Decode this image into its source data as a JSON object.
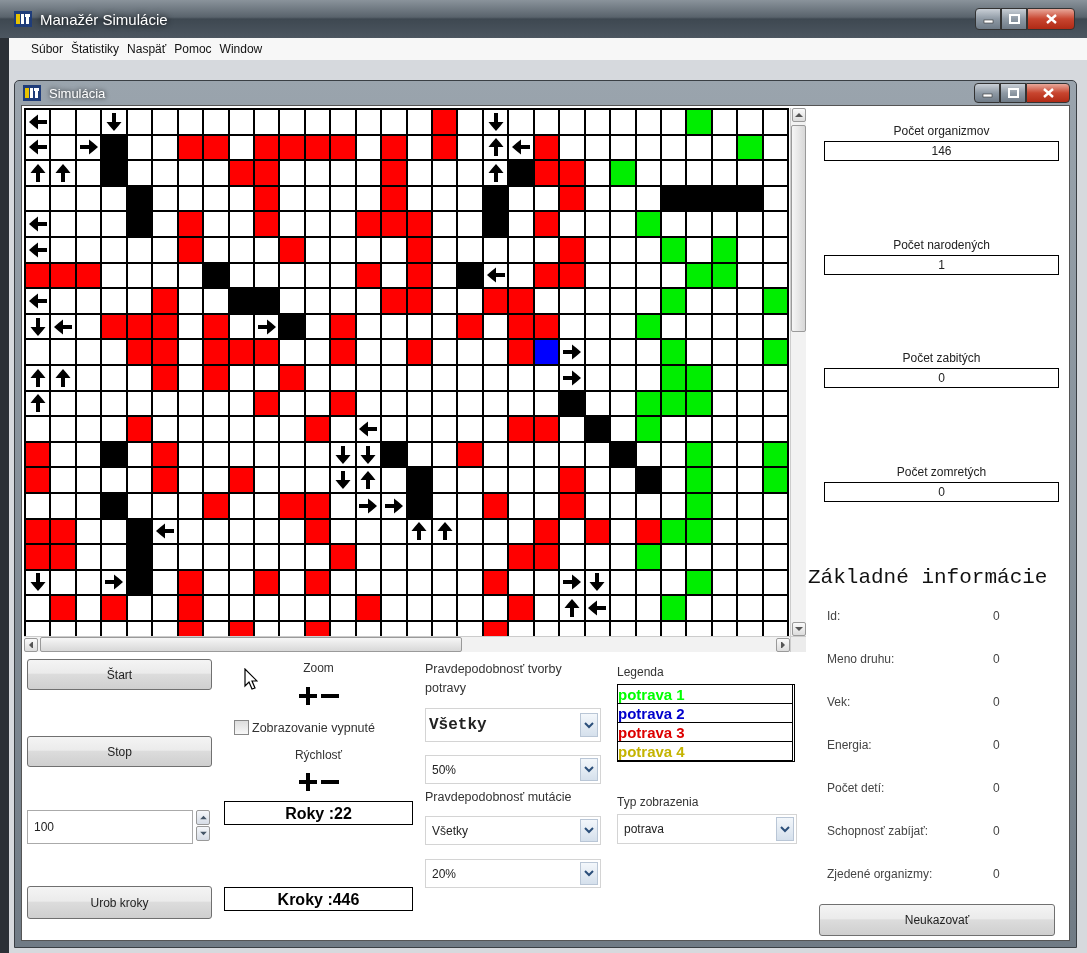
{
  "window": {
    "title": "Manažér Simulácie"
  },
  "menu": [
    "Súbor",
    "Štatistiky",
    "Naspäť",
    "Pomoc",
    "Window"
  ],
  "simulation_window": {
    "title": "Simulácia"
  },
  "grid": {
    "rows": [
      [
        {
          "kind": "arrow_left"
        },
        {
          "kind": "empty"
        },
        {
          "kind": "empty"
        },
        {
          "kind": "arrow_down"
        },
        {
          "kind": "empty"
        },
        {
          "kind": "empty"
        },
        {
          "kind": "empty"
        },
        {
          "kind": "empty"
        },
        {
          "kind": "empty"
        },
        {
          "kind": "empty"
        },
        {
          "kind": "empty"
        },
        {
          "kind": "empty"
        },
        {
          "kind": "empty"
        },
        {
          "kind": "empty"
        },
        {
          "kind": "empty"
        },
        {
          "kind": "empty"
        },
        {
          "kind": "filled",
          "color": "#ff0000"
        },
        {
          "kind": "empty"
        },
        {
          "kind": "arrow_down"
        },
        {
          "kind": "empty"
        },
        {
          "kind": "empty"
        },
        {
          "kind": "empty"
        },
        {
          "kind": "empty"
        },
        {
          "kind": "empty"
        },
        {
          "kind": "empty"
        },
        {
          "kind": "empty"
        },
        {
          "kind": "filled",
          "color": "#00ee00"
        },
        {
          "kind": "empty"
        },
        {
          "kind": "empty"
        },
        {
          "kind": "empty"
        }
      ],
      [
        {
          "kind": "arrow_left"
        },
        {
          "kind": "empty"
        },
        {
          "kind": "arrow_right"
        },
        {
          "kind": "filled",
          "color": "#000000"
        },
        {
          "kind": "empty"
        },
        {
          "kind": "empty"
        },
        {
          "kind": "filled",
          "color": "#ff0000"
        },
        {
          "kind": "filled",
          "color": "#ff0000"
        },
        {
          "kind": "empty"
        },
        {
          "kind": "filled",
          "color": "#ff0000"
        },
        {
          "kind": "filled",
          "color": "#ff0000"
        },
        {
          "kind": "filled",
          "color": "#ff0000"
        },
        {
          "kind": "filled",
          "color": "#ff0000"
        },
        {
          "kind": "empty"
        },
        {
          "kind": "filled",
          "color": "#ff0000"
        },
        {
          "kind": "empty"
        },
        {
          "kind": "filled",
          "color": "#ff0000"
        },
        {
          "kind": "empty"
        },
        {
          "kind": "arrow_up"
        },
        {
          "kind": "arrow_left"
        },
        {
          "kind": "filled",
          "color": "#ff0000"
        },
        {
          "kind": "empty"
        },
        {
          "kind": "empty"
        },
        {
          "kind": "empty"
        },
        {
          "kind": "empty"
        },
        {
          "kind": "empty"
        },
        {
          "kind": "empty"
        },
        {
          "kind": "empty"
        },
        {
          "kind": "filled",
          "color": "#00ee00"
        },
        {
          "kind": "empty"
        }
      ],
      [
        {
          "kind": "arrow_up"
        },
        {
          "kind": "arrow_up"
        },
        {
          "kind": "empty"
        },
        {
          "kind": "filled",
          "color": "#000000"
        },
        {
          "kind": "empty"
        },
        {
          "kind": "empty"
        },
        {
          "kind": "empty"
        },
        {
          "kind": "empty"
        },
        {
          "kind": "filled",
          "color": "#ff0000"
        },
        {
          "kind": "filled",
          "color": "#ff0000"
        },
        {
          "kind": "empty"
        },
        {
          "kind": "empty"
        },
        {
          "kind": "empty"
        },
        {
          "kind": "empty"
        },
        {
          "kind": "filled",
          "color": "#ff0000"
        },
        {
          "kind": "empty"
        },
        {
          "kind": "empty"
        },
        {
          "kind": "empty"
        },
        {
          "kind": "arrow_up"
        },
        {
          "kind": "filled",
          "color": "#000000"
        },
        {
          "kind": "filled",
          "color": "#ff0000"
        },
        {
          "kind": "filled",
          "color": "#ff0000"
        },
        {
          "kind": "empty"
        },
        {
          "kind": "filled",
          "color": "#00ee00"
        },
        {
          "kind": "empty"
        },
        {
          "kind": "empty"
        },
        {
          "kind": "empty"
        },
        {
          "kind": "empty"
        },
        {
          "kind": "empty"
        },
        {
          "kind": "empty"
        }
      ],
      [
        {
          "kind": "empty"
        },
        {
          "kind": "empty"
        },
        {
          "kind": "empty"
        },
        {
          "kind": "empty"
        },
        {
          "kind": "filled",
          "color": "#000000"
        },
        {
          "kind": "empty"
        },
        {
          "kind": "empty"
        },
        {
          "kind": "empty"
        },
        {
          "kind": "empty"
        },
        {
          "kind": "filled",
          "color": "#ff0000"
        },
        {
          "kind": "empty"
        },
        {
          "kind": "empty"
        },
        {
          "kind": "empty"
        },
        {
          "kind": "empty"
        },
        {
          "kind": "filled",
          "color": "#ff0000"
        },
        {
          "kind": "empty"
        },
        {
          "kind": "empty"
        },
        {
          "kind": "empty"
        },
        {
          "kind": "filled",
          "color": "#000000"
        },
        {
          "kind": "empty"
        },
        {
          "kind": "empty"
        },
        {
          "kind": "filled",
          "color": "#ff0000"
        },
        {
          "kind": "empty"
        },
        {
          "kind": "empty"
        },
        {
          "kind": "empty"
        },
        {
          "kind": "filled",
          "color": "#000000"
        },
        {
          "kind": "filled",
          "color": "#000000"
        },
        {
          "kind": "filled",
          "color": "#000000"
        },
        {
          "kind": "filled",
          "color": "#000000"
        },
        {
          "kind": "empty"
        }
      ],
      [
        {
          "kind": "arrow_left"
        },
        {
          "kind": "empty"
        },
        {
          "kind": "empty"
        },
        {
          "kind": "empty"
        },
        {
          "kind": "filled",
          "color": "#000000"
        },
        {
          "kind": "empty"
        },
        {
          "kind": "filled",
          "color": "#ff0000"
        },
        {
          "kind": "empty"
        },
        {
          "kind": "empty"
        },
        {
          "kind": "filled",
          "color": "#ff0000"
        },
        {
          "kind": "empty"
        },
        {
          "kind": "empty"
        },
        {
          "kind": "empty"
        },
        {
          "kind": "filled",
          "color": "#ff0000"
        },
        {
          "kind": "filled",
          "color": "#ff0000"
        },
        {
          "kind": "filled",
          "color": "#ff0000"
        },
        {
          "kind": "empty"
        },
        {
          "kind": "empty"
        },
        {
          "kind": "filled",
          "color": "#000000"
        },
        {
          "kind": "empty"
        },
        {
          "kind": "filled",
          "color": "#ff0000"
        },
        {
          "kind": "empty"
        },
        {
          "kind": "empty"
        },
        {
          "kind": "empty"
        },
        {
          "kind": "filled",
          "color": "#00ee00"
        },
        {
          "kind": "empty"
        },
        {
          "kind": "empty"
        },
        {
          "kind": "empty"
        },
        {
          "kind": "empty"
        },
        {
          "kind": "empty"
        }
      ],
      [
        {
          "kind": "arrow_left"
        },
        {
          "kind": "empty"
        },
        {
          "kind": "empty"
        },
        {
          "kind": "empty"
        },
        {
          "kind": "empty"
        },
        {
          "kind": "empty"
        },
        {
          "kind": "filled",
          "color": "#ff0000"
        },
        {
          "kind": "empty"
        },
        {
          "kind": "empty"
        },
        {
          "kind": "empty"
        },
        {
          "kind": "filled",
          "color": "#ff0000"
        },
        {
          "kind": "empty"
        },
        {
          "kind": "empty"
        },
        {
          "kind": "empty"
        },
        {
          "kind": "empty"
        },
        {
          "kind": "filled",
          "color": "#ff0000"
        },
        {
          "kind": "empty"
        },
        {
          "kind": "empty"
        },
        {
          "kind": "empty"
        },
        {
          "kind": "empty"
        },
        {
          "kind": "empty"
        },
        {
          "kind": "filled",
          "color": "#ff0000"
        },
        {
          "kind": "empty"
        },
        {
          "kind": "empty"
        },
        {
          "kind": "empty"
        },
        {
          "kind": "filled",
          "color": "#00ee00"
        },
        {
          "kind": "empty"
        },
        {
          "kind": "filled",
          "color": "#00ee00"
        },
        {
          "kind": "empty"
        },
        {
          "kind": "empty"
        }
      ],
      [
        {
          "kind": "filled",
          "color": "#ff0000"
        },
        {
          "kind": "filled",
          "color": "#ff0000"
        },
        {
          "kind": "filled",
          "color": "#ff0000"
        },
        {
          "kind": "empty"
        },
        {
          "kind": "empty"
        },
        {
          "kind": "empty"
        },
        {
          "kind": "empty"
        },
        {
          "kind": "filled",
          "color": "#000000"
        },
        {
          "kind": "empty"
        },
        {
          "kind": "empty"
        },
        {
          "kind": "empty"
        },
        {
          "kind": "empty"
        },
        {
          "kind": "empty"
        },
        {
          "kind": "filled",
          "color": "#ff0000"
        },
        {
          "kind": "empty"
        },
        {
          "kind": "filled",
          "color": "#ff0000"
        },
        {
          "kind": "empty"
        },
        {
          "kind": "filled",
          "color": "#000000"
        },
        {
          "kind": "arrow_left"
        },
        {
          "kind": "empty"
        },
        {
          "kind": "filled",
          "color": "#ff0000"
        },
        {
          "kind": "filled",
          "color": "#ff0000"
        },
        {
          "kind": "empty"
        },
        {
          "kind": "empty"
        },
        {
          "kind": "empty"
        },
        {
          "kind": "empty"
        },
        {
          "kind": "filled",
          "color": "#00ee00"
        },
        {
          "kind": "filled",
          "color": "#00ee00"
        },
        {
          "kind": "empty"
        },
        {
          "kind": "empty"
        }
      ],
      [
        {
          "kind": "arrow_left"
        },
        {
          "kind": "empty"
        },
        {
          "kind": "empty"
        },
        {
          "kind": "empty"
        },
        {
          "kind": "empty"
        },
        {
          "kind": "filled",
          "color": "#ff0000"
        },
        {
          "kind": "empty"
        },
        {
          "kind": "empty"
        },
        {
          "kind": "filled",
          "color": "#000000"
        },
        {
          "kind": "filled",
          "color": "#000000"
        },
        {
          "kind": "empty"
        },
        {
          "kind": "empty"
        },
        {
          "kind": "empty"
        },
        {
          "kind": "empty"
        },
        {
          "kind": "filled",
          "color": "#ff0000"
        },
        {
          "kind": "filled",
          "color": "#ff0000"
        },
        {
          "kind": "empty"
        },
        {
          "kind": "empty"
        },
        {
          "kind": "filled",
          "color": "#ff0000"
        },
        {
          "kind": "filled",
          "color": "#ff0000"
        },
        {
          "kind": "empty"
        },
        {
          "kind": "empty"
        },
        {
          "kind": "empty"
        },
        {
          "kind": "empty"
        },
        {
          "kind": "empty"
        },
        {
          "kind": "filled",
          "color": "#00ee00"
        },
        {
          "kind": "empty"
        },
        {
          "kind": "empty"
        },
        {
          "kind": "empty"
        },
        {
          "kind": "filled",
          "color": "#00ee00"
        }
      ],
      [
        {
          "kind": "arrow_down"
        },
        {
          "kind": "arrow_left"
        },
        {
          "kind": "empty"
        },
        {
          "kind": "filled",
          "color": "#ff0000"
        },
        {
          "kind": "filled",
          "color": "#ff0000"
        },
        {
          "kind": "filled",
          "color": "#ff0000"
        },
        {
          "kind": "empty"
        },
        {
          "kind": "filled",
          "color": "#ff0000"
        },
        {
          "kind": "empty"
        },
        {
          "kind": "arrow_right"
        },
        {
          "kind": "filled",
          "color": "#000000"
        },
        {
          "kind": "empty"
        },
        {
          "kind": "filled",
          "color": "#ff0000"
        },
        {
          "kind": "empty"
        },
        {
          "kind": "empty"
        },
        {
          "kind": "empty"
        },
        {
          "kind": "empty"
        },
        {
          "kind": "filled",
          "color": "#ff0000"
        },
        {
          "kind": "empty"
        },
        {
          "kind": "filled",
          "color": "#ff0000"
        },
        {
          "kind": "filled",
          "color": "#ff0000"
        },
        {
          "kind": "empty"
        },
        {
          "kind": "empty"
        },
        {
          "kind": "empty"
        },
        {
          "kind": "filled",
          "color": "#00ee00"
        },
        {
          "kind": "empty"
        },
        {
          "kind": "empty"
        },
        {
          "kind": "empty"
        },
        {
          "kind": "empty"
        },
        {
          "kind": "empty"
        }
      ],
      [
        {
          "kind": "empty"
        },
        {
          "kind": "empty"
        },
        {
          "kind": "empty"
        },
        {
          "kind": "empty"
        },
        {
          "kind": "filled",
          "color": "#ff0000"
        },
        {
          "kind": "filled",
          "color": "#ff0000"
        },
        {
          "kind": "empty"
        },
        {
          "kind": "filled",
          "color": "#ff0000"
        },
        {
          "kind": "filled",
          "color": "#ff0000"
        },
        {
          "kind": "filled",
          "color": "#ff0000"
        },
        {
          "kind": "empty"
        },
        {
          "kind": "empty"
        },
        {
          "kind": "filled",
          "color": "#ff0000"
        },
        {
          "kind": "empty"
        },
        {
          "kind": "empty"
        },
        {
          "kind": "filled",
          "color": "#ff0000"
        },
        {
          "kind": "empty"
        },
        {
          "kind": "empty"
        },
        {
          "kind": "empty"
        },
        {
          "kind": "filled",
          "color": "#ff0000"
        },
        {
          "kind": "filled",
          "color": "#0000ff"
        },
        {
          "kind": "arrow_right"
        },
        {
          "kind": "empty"
        },
        {
          "kind": "empty"
        },
        {
          "kind": "empty"
        },
        {
          "kind": "filled",
          "color": "#00ee00"
        },
        {
          "kind": "empty"
        },
        {
          "kind": "empty"
        },
        {
          "kind": "empty"
        },
        {
          "kind": "filled",
          "color": "#00ee00"
        }
      ],
      [
        {
          "kind": "arrow_up"
        },
        {
          "kind": "arrow_up"
        },
        {
          "kind": "empty"
        },
        {
          "kind": "empty"
        },
        {
          "kind": "empty"
        },
        {
          "kind": "filled",
          "color": "#ff0000"
        },
        {
          "kind": "empty"
        },
        {
          "kind": "filled",
          "color": "#ff0000"
        },
        {
          "kind": "empty"
        },
        {
          "kind": "empty"
        },
        {
          "kind": "filled",
          "color": "#ff0000"
        },
        {
          "kind": "empty"
        },
        {
          "kind": "empty"
        },
        {
          "kind": "empty"
        },
        {
          "kind": "empty"
        },
        {
          "kind": "empty"
        },
        {
          "kind": "empty"
        },
        {
          "kind": "empty"
        },
        {
          "kind": "empty"
        },
        {
          "kind": "empty"
        },
        {
          "kind": "empty"
        },
        {
          "kind": "arrow_right"
        },
        {
          "kind": "empty"
        },
        {
          "kind": "empty"
        },
        {
          "kind": "empty"
        },
        {
          "kind": "filled",
          "color": "#00ee00"
        },
        {
          "kind": "filled",
          "color": "#00ee00"
        },
        {
          "kind": "empty"
        },
        {
          "kind": "empty"
        },
        {
          "kind": "empty"
        }
      ],
      [
        {
          "kind": "arrow_up"
        },
        {
          "kind": "empty"
        },
        {
          "kind": "empty"
        },
        {
          "kind": "empty"
        },
        {
          "kind": "empty"
        },
        {
          "kind": "empty"
        },
        {
          "kind": "empty"
        },
        {
          "kind": "empty"
        },
        {
          "kind": "empty"
        },
        {
          "kind": "filled",
          "color": "#ff0000"
        },
        {
          "kind": "empty"
        },
        {
          "kind": "empty"
        },
        {
          "kind": "filled",
          "color": "#ff0000"
        },
        {
          "kind": "empty"
        },
        {
          "kind": "empty"
        },
        {
          "kind": "empty"
        },
        {
          "kind": "empty"
        },
        {
          "kind": "empty"
        },
        {
          "kind": "empty"
        },
        {
          "kind": "empty"
        },
        {
          "kind": "empty"
        },
        {
          "kind": "filled",
          "color": "#000000"
        },
        {
          "kind": "empty"
        },
        {
          "kind": "empty"
        },
        {
          "kind": "filled",
          "color": "#00ee00"
        },
        {
          "kind": "filled",
          "color": "#00ee00"
        },
        {
          "kind": "filled",
          "color": "#00ee00"
        },
        {
          "kind": "empty"
        },
        {
          "kind": "empty"
        },
        {
          "kind": "empty"
        }
      ],
      [
        {
          "kind": "empty"
        },
        {
          "kind": "empty"
        },
        {
          "kind": "empty"
        },
        {
          "kind": "empty"
        },
        {
          "kind": "filled",
          "color": "#ff0000"
        },
        {
          "kind": "empty"
        },
        {
          "kind": "empty"
        },
        {
          "kind": "empty"
        },
        {
          "kind": "empty"
        },
        {
          "kind": "empty"
        },
        {
          "kind": "empty"
        },
        {
          "kind": "filled",
          "color": "#ff0000"
        },
        {
          "kind": "empty"
        },
        {
          "kind": "arrow_left"
        },
        {
          "kind": "empty"
        },
        {
          "kind": "empty"
        },
        {
          "kind": "empty"
        },
        {
          "kind": "empty"
        },
        {
          "kind": "empty"
        },
        {
          "kind": "filled",
          "color": "#ff0000"
        },
        {
          "kind": "filled",
          "color": "#ff0000"
        },
        {
          "kind": "empty"
        },
        {
          "kind": "filled",
          "color": "#000000"
        },
        {
          "kind": "empty"
        },
        {
          "kind": "filled",
          "color": "#00ee00"
        },
        {
          "kind": "empty"
        },
        {
          "kind": "empty"
        },
        {
          "kind": "empty"
        },
        {
          "kind": "empty"
        },
        {
          "kind": "empty"
        }
      ],
      [
        {
          "kind": "filled",
          "color": "#ff0000"
        },
        {
          "kind": "empty"
        },
        {
          "kind": "empty"
        },
        {
          "kind": "filled",
          "color": "#000000"
        },
        {
          "kind": "empty"
        },
        {
          "kind": "filled",
          "color": "#ff0000"
        },
        {
          "kind": "empty"
        },
        {
          "kind": "empty"
        },
        {
          "kind": "empty"
        },
        {
          "kind": "empty"
        },
        {
          "kind": "empty"
        },
        {
          "kind": "empty"
        },
        {
          "kind": "arrow_down"
        },
        {
          "kind": "arrow_down"
        },
        {
          "kind": "filled",
          "color": "#000000"
        },
        {
          "kind": "empty"
        },
        {
          "kind": "empty"
        },
        {
          "kind": "filled",
          "color": "#ff0000"
        },
        {
          "kind": "empty"
        },
        {
          "kind": "empty"
        },
        {
          "kind": "empty"
        },
        {
          "kind": "empty"
        },
        {
          "kind": "empty"
        },
        {
          "kind": "filled",
          "color": "#000000"
        },
        {
          "kind": "empty"
        },
        {
          "kind": "empty"
        },
        {
          "kind": "filled",
          "color": "#00ee00"
        },
        {
          "kind": "empty"
        },
        {
          "kind": "empty"
        },
        {
          "kind": "filled",
          "color": "#00ee00"
        }
      ],
      [
        {
          "kind": "filled",
          "color": "#ff0000"
        },
        {
          "kind": "empty"
        },
        {
          "kind": "empty"
        },
        {
          "kind": "empty"
        },
        {
          "kind": "empty"
        },
        {
          "kind": "filled",
          "color": "#ff0000"
        },
        {
          "kind": "empty"
        },
        {
          "kind": "empty"
        },
        {
          "kind": "filled",
          "color": "#ff0000"
        },
        {
          "kind": "empty"
        },
        {
          "kind": "empty"
        },
        {
          "kind": "empty"
        },
        {
          "kind": "arrow_down"
        },
        {
          "kind": "arrow_up"
        },
        {
          "kind": "empty"
        },
        {
          "kind": "filled",
          "color": "#000000"
        },
        {
          "kind": "empty"
        },
        {
          "kind": "empty"
        },
        {
          "kind": "empty"
        },
        {
          "kind": "empty"
        },
        {
          "kind": "empty"
        },
        {
          "kind": "filled",
          "color": "#ff0000"
        },
        {
          "kind": "empty"
        },
        {
          "kind": "empty"
        },
        {
          "kind": "filled",
          "color": "#000000"
        },
        {
          "kind": "empty"
        },
        {
          "kind": "filled",
          "color": "#00ee00"
        },
        {
          "kind": "empty"
        },
        {
          "kind": "empty"
        },
        {
          "kind": "filled",
          "color": "#00ee00"
        }
      ],
      [
        {
          "kind": "empty"
        },
        {
          "kind": "empty"
        },
        {
          "kind": "empty"
        },
        {
          "kind": "filled",
          "color": "#000000"
        },
        {
          "kind": "empty"
        },
        {
          "kind": "empty"
        },
        {
          "kind": "empty"
        },
        {
          "kind": "filled",
          "color": "#ff0000"
        },
        {
          "kind": "empty"
        },
        {
          "kind": "empty"
        },
        {
          "kind": "filled",
          "color": "#ff0000"
        },
        {
          "kind": "filled",
          "color": "#ff0000"
        },
        {
          "kind": "empty"
        },
        {
          "kind": "arrow_right"
        },
        {
          "kind": "arrow_right"
        },
        {
          "kind": "filled",
          "color": "#000000"
        },
        {
          "kind": "empty"
        },
        {
          "kind": "empty"
        },
        {
          "kind": "filled",
          "color": "#ff0000"
        },
        {
          "kind": "empty"
        },
        {
          "kind": "empty"
        },
        {
          "kind": "filled",
          "color": "#ff0000"
        },
        {
          "kind": "empty"
        },
        {
          "kind": "empty"
        },
        {
          "kind": "empty"
        },
        {
          "kind": "empty"
        },
        {
          "kind": "filled",
          "color": "#00ee00"
        },
        {
          "kind": "empty"
        },
        {
          "kind": "empty"
        },
        {
          "kind": "empty"
        }
      ],
      [
        {
          "kind": "filled",
          "color": "#ff0000"
        },
        {
          "kind": "filled",
          "color": "#ff0000"
        },
        {
          "kind": "empty"
        },
        {
          "kind": "empty"
        },
        {
          "kind": "filled",
          "color": "#000000"
        },
        {
          "kind": "arrow_left"
        },
        {
          "kind": "empty"
        },
        {
          "kind": "empty"
        },
        {
          "kind": "empty"
        },
        {
          "kind": "empty"
        },
        {
          "kind": "empty"
        },
        {
          "kind": "filled",
          "color": "#ff0000"
        },
        {
          "kind": "empty"
        },
        {
          "kind": "empty"
        },
        {
          "kind": "empty"
        },
        {
          "kind": "arrow_up"
        },
        {
          "kind": "arrow_up"
        },
        {
          "kind": "empty"
        },
        {
          "kind": "empty"
        },
        {
          "kind": "empty"
        },
        {
          "kind": "filled",
          "color": "#ff0000"
        },
        {
          "kind": "empty"
        },
        {
          "kind": "filled",
          "color": "#ff0000"
        },
        {
          "kind": "empty"
        },
        {
          "kind": "filled",
          "color": "#ff0000"
        },
        {
          "kind": "filled",
          "color": "#00ee00"
        },
        {
          "kind": "filled",
          "color": "#00ee00"
        },
        {
          "kind": "empty"
        },
        {
          "kind": "empty"
        },
        {
          "kind": "empty"
        }
      ],
      [
        {
          "kind": "filled",
          "color": "#ff0000"
        },
        {
          "kind": "filled",
          "color": "#ff0000"
        },
        {
          "kind": "empty"
        },
        {
          "kind": "empty"
        },
        {
          "kind": "filled",
          "color": "#000000"
        },
        {
          "kind": "empty"
        },
        {
          "kind": "empty"
        },
        {
          "kind": "empty"
        },
        {
          "kind": "empty"
        },
        {
          "kind": "empty"
        },
        {
          "kind": "empty"
        },
        {
          "kind": "empty"
        },
        {
          "kind": "filled",
          "color": "#ff0000"
        },
        {
          "kind": "empty"
        },
        {
          "kind": "empty"
        },
        {
          "kind": "empty"
        },
        {
          "kind": "empty"
        },
        {
          "kind": "empty"
        },
        {
          "kind": "empty"
        },
        {
          "kind": "filled",
          "color": "#ff0000"
        },
        {
          "kind": "filled",
          "color": "#ff0000"
        },
        {
          "kind": "empty"
        },
        {
          "kind": "empty"
        },
        {
          "kind": "empty"
        },
        {
          "kind": "filled",
          "color": "#00ee00"
        },
        {
          "kind": "empty"
        },
        {
          "kind": "empty"
        },
        {
          "kind": "empty"
        },
        {
          "kind": "empty"
        },
        {
          "kind": "empty"
        }
      ],
      [
        {
          "kind": "arrow_down"
        },
        {
          "kind": "empty"
        },
        {
          "kind": "empty"
        },
        {
          "kind": "arrow_right"
        },
        {
          "kind": "filled",
          "color": "#000000"
        },
        {
          "kind": "empty"
        },
        {
          "kind": "filled",
          "color": "#ff0000"
        },
        {
          "kind": "empty"
        },
        {
          "kind": "empty"
        },
        {
          "kind": "filled",
          "color": "#ff0000"
        },
        {
          "kind": "empty"
        },
        {
          "kind": "filled",
          "color": "#ff0000"
        },
        {
          "kind": "empty"
        },
        {
          "kind": "empty"
        },
        {
          "kind": "empty"
        },
        {
          "kind": "empty"
        },
        {
          "kind": "empty"
        },
        {
          "kind": "empty"
        },
        {
          "kind": "filled",
          "color": "#ff0000"
        },
        {
          "kind": "empty"
        },
        {
          "kind": "empty"
        },
        {
          "kind": "arrow_right"
        },
        {
          "kind": "arrow_down"
        },
        {
          "kind": "empty"
        },
        {
          "kind": "empty"
        },
        {
          "kind": "empty"
        },
        {
          "kind": "filled",
          "color": "#00ee00"
        },
        {
          "kind": "empty"
        },
        {
          "kind": "empty"
        },
        {
          "kind": "empty"
        }
      ],
      [
        {
          "kind": "empty"
        },
        {
          "kind": "filled",
          "color": "#ff0000"
        },
        {
          "kind": "empty"
        },
        {
          "kind": "filled",
          "color": "#ff0000"
        },
        {
          "kind": "empty"
        },
        {
          "kind": "empty"
        },
        {
          "kind": "filled",
          "color": "#ff0000"
        },
        {
          "kind": "empty"
        },
        {
          "kind": "empty"
        },
        {
          "kind": "empty"
        },
        {
          "kind": "empty"
        },
        {
          "kind": "empty"
        },
        {
          "kind": "empty"
        },
        {
          "kind": "filled",
          "color": "#ff0000"
        },
        {
          "kind": "empty"
        },
        {
          "kind": "empty"
        },
        {
          "kind": "empty"
        },
        {
          "kind": "empty"
        },
        {
          "kind": "empty"
        },
        {
          "kind": "filled",
          "color": "#ff0000"
        },
        {
          "kind": "empty"
        },
        {
          "kind": "arrow_up"
        },
        {
          "kind": "arrow_left"
        },
        {
          "kind": "empty"
        },
        {
          "kind": "empty"
        },
        {
          "kind": "filled",
          "color": "#00ee00"
        },
        {
          "kind": "empty"
        },
        {
          "kind": "empty"
        },
        {
          "kind": "empty"
        },
        {
          "kind": "empty"
        }
      ],
      [
        {
          "kind": "empty"
        },
        {
          "kind": "empty"
        },
        {
          "kind": "empty"
        },
        {
          "kind": "empty"
        },
        {
          "kind": "empty"
        },
        {
          "kind": "empty"
        },
        {
          "kind": "filled",
          "color": "#ff0000"
        },
        {
          "kind": "empty"
        },
        {
          "kind": "filled",
          "color": "#ff0000"
        },
        {
          "kind": "empty"
        },
        {
          "kind": "empty"
        },
        {
          "kind": "filled",
          "color": "#ff0000"
        },
        {
          "kind": "empty"
        },
        {
          "kind": "empty"
        },
        {
          "kind": "empty"
        },
        {
          "kind": "empty"
        },
        {
          "kind": "empty"
        },
        {
          "kind": "empty"
        },
        {
          "kind": "filled",
          "color": "#ff0000"
        },
        {
          "kind": "empty"
        },
        {
          "kind": "empty"
        },
        {
          "kind": "empty"
        },
        {
          "kind": "empty"
        },
        {
          "kind": "empty"
        },
        {
          "kind": "empty"
        },
        {
          "kind": "empty"
        },
        {
          "kind": "empty"
        },
        {
          "kind": "empty"
        },
        {
          "kind": "empty"
        },
        {
          "kind": "empty"
        }
      ]
    ]
  },
  "controls": {
    "start_button": "Štart",
    "stop_button": "Stop",
    "steps_input": {
      "value": "100"
    },
    "steps_button": "Urob kroky",
    "zoom": {
      "label": "Zoom"
    },
    "display_off": {
      "label": "Zobrazovanie vypnuté",
      "checked": false
    },
    "speed": {
      "label": "Rýchlosť"
    },
    "years": "Roky :22",
    "steps": "Kroky :446",
    "food_probability": {
      "label": "Pravdepodobnosť tvorby potravy",
      "type": "Všetky",
      "value": "50%"
    },
    "mutation_probability": {
      "label": "Pravdepodobnosť mutácie",
      "type": "Všetky",
      "value": "20%"
    },
    "legend": {
      "title": "Legenda",
      "items": [
        {
          "label": "potrava 1",
          "color": "#00ff00"
        },
        {
          "label": "potrava 2",
          "color": "#0000cc"
        },
        {
          "label": "potrava 3",
          "color": "#dd0000"
        },
        {
          "label": "potrava 4",
          "color": "#c4b400"
        }
      ]
    },
    "display_type": {
      "label": "Typ zobrazenia",
      "value": "potrava"
    }
  },
  "stats": [
    {
      "label": "Počet organizmov",
      "value": "146"
    },
    {
      "label": "Počet narodených",
      "value": "1"
    },
    {
      "label": "Počet zabitých",
      "value": "0"
    },
    {
      "label": "Počet zomretých",
      "value": "0"
    }
  ],
  "info": {
    "title": "Základné informácie",
    "rows": [
      {
        "label": "Id:",
        "value": "0"
      },
      {
        "label": "Meno druhu:",
        "value": "0"
      },
      {
        "label": "Vek:",
        "value": "0"
      },
      {
        "label": "Energia:",
        "value": "0"
      },
      {
        "label": "Počet detí:",
        "value": "0"
      },
      {
        "label": "Schopnosť zabíjať:",
        "value": "0"
      },
      {
        "label": "Zjedené organizmy:",
        "value": "0"
      }
    ]
  },
  "hide_button": "Neukazovať"
}
